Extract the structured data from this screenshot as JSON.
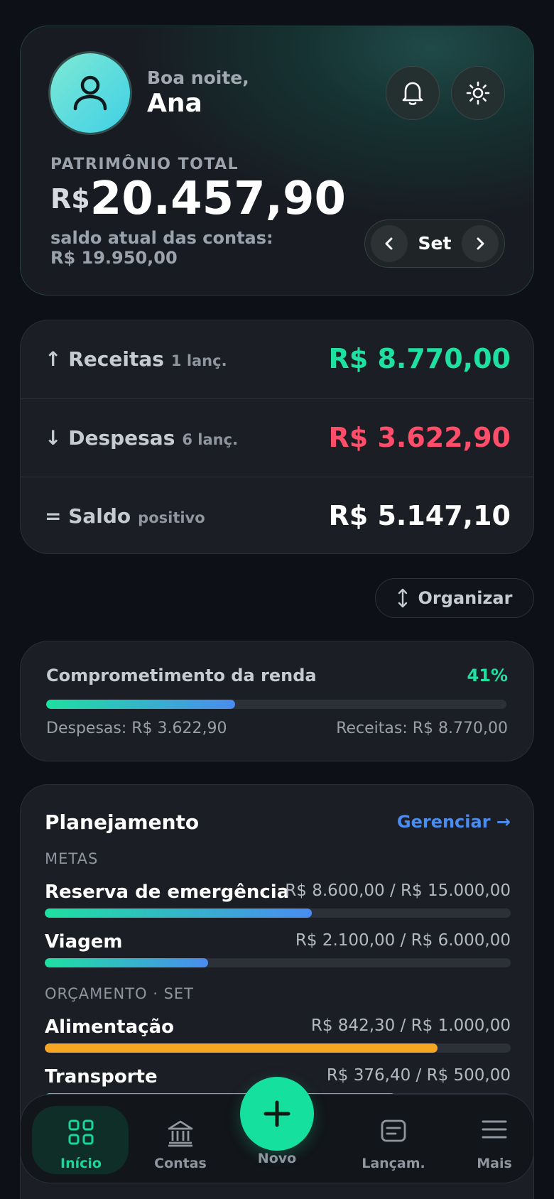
{
  "header": {
    "greeting": "Boa noite,",
    "user_name": "Ana",
    "total_label": "PATRIMÔNIO TOTAL",
    "total_currency": "R$",
    "total_value": "20.457,90",
    "balance_label": "saldo atual das contas:",
    "balance_value": "R$ 19.950,00",
    "month": "Set",
    "icons": {
      "avatar": "user-icon",
      "notifications": "bell-icon",
      "theme": "sun-icon",
      "prev": "chevron-left-icon",
      "next": "chevron-right-icon"
    }
  },
  "summary": {
    "income": {
      "label": "↑ Receitas",
      "count": "1 lanç.",
      "amount": "R$ 8.770,00",
      "color": "#1ee0a0"
    },
    "expenses": {
      "label": "↓ Despesas",
      "count": "6 lanç.",
      "amount": "R$ 3.622,90",
      "color": "#ff4d6a"
    },
    "balance": {
      "label": "= Saldo",
      "status": "positivo",
      "amount": "R$ 5.147,10",
      "color": "#ffffff"
    }
  },
  "organize_label": "Organizar",
  "commitment": {
    "title": "Comprometimento da renda",
    "percent": "41%",
    "fraction": 0.41,
    "expenses_text": "Despesas: R$ 3.622,90",
    "income_text": "Receitas: R$ 8.770,00"
  },
  "planning": {
    "title": "Planejamento",
    "manage": "Gerenciar →",
    "goals_label": "METAS",
    "goals": [
      {
        "name": "Reserva de emergência",
        "value": "R$ 8.600,00 / R$ 15.000,00",
        "fraction": 0.5733
      },
      {
        "name": "Viagem",
        "value": "R$ 2.100,00 / R$ 6.000,00",
        "fraction": 0.35
      }
    ],
    "budget_label": "ORÇAMENTO · SET",
    "budgets": [
      {
        "name": "Alimentação",
        "value": "R$ 842,30 / R$ 1.000,00",
        "fraction": 0.8423,
        "color": "#f5a623"
      },
      {
        "name": "Transporte",
        "value": "R$ 376,40 / R$ 500,00",
        "fraction": 0.7528,
        "color": "#1ee0a0"
      }
    ]
  },
  "nav": {
    "items": [
      {
        "label": "Início",
        "icon": "grid-icon",
        "active": true
      },
      {
        "label": "Contas",
        "icon": "bank-icon",
        "active": false
      },
      {
        "label": "Novo",
        "icon": "plus-icon",
        "active": false
      },
      {
        "label": "Lançam.",
        "icon": "receipt-icon",
        "active": false
      },
      {
        "label": "Mais",
        "icon": "menu-icon",
        "active": false
      }
    ]
  },
  "colors": {
    "accent": "#16e09e",
    "income": "#1ee0a0",
    "expense": "#ff4d6a",
    "link": "#4a8cf0",
    "goal_gradient_start": "#1ee0a0",
    "goal_gradient_end": "#4a8cf0"
  }
}
